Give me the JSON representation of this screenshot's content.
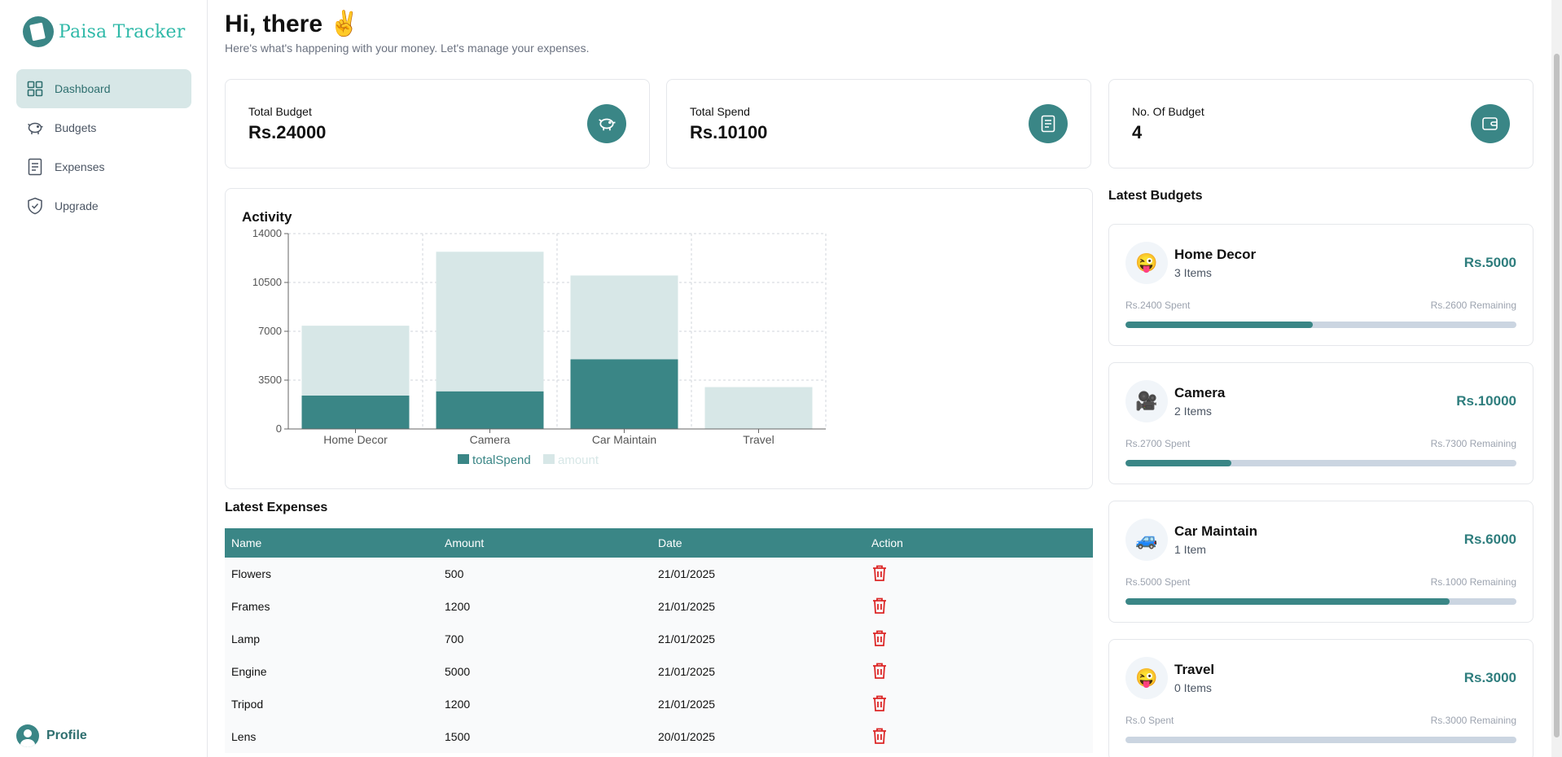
{
  "app": {
    "name": "Paisa Tracker"
  },
  "sidebar": {
    "items": [
      {
        "label": "Dashboard",
        "icon": "grid-icon",
        "active": true
      },
      {
        "label": "Budgets",
        "icon": "piggy-bank-icon",
        "active": false
      },
      {
        "label": "Expenses",
        "icon": "receipt-icon",
        "active": false
      },
      {
        "label": "Upgrade",
        "icon": "shield-check-icon",
        "active": false
      }
    ],
    "profile_label": "Profile"
  },
  "header": {
    "greeting": "Hi, there ✌️",
    "subtitle": "Here's what's happening with your money. Let's manage your expenses."
  },
  "stats": [
    {
      "label": "Total Budget",
      "value": "Rs.24000",
      "icon": "piggy-bank-icon"
    },
    {
      "label": "Total Spend",
      "value": "Rs.10100",
      "icon": "receipt-icon"
    },
    {
      "label": "No. Of Budget",
      "value": "4",
      "icon": "wallet-icon"
    }
  ],
  "activity": {
    "title": "Activity"
  },
  "chart_data": {
    "type": "bar",
    "stacked": true,
    "categories": [
      "Home Decor",
      "Camera",
      "Car Maintain",
      "Travel"
    ],
    "series": [
      {
        "name": "totalSpend",
        "values": [
          2400,
          2700,
          5000,
          0
        ],
        "color": "#3a8686"
      },
      {
        "name": "amount",
        "values": [
          5000,
          10000,
          6000,
          3000
        ],
        "color": "#d7e7e7"
      }
    ],
    "yticks": [
      0,
      3500,
      7000,
      10500,
      14000
    ],
    "ylim": [
      0,
      14000
    ],
    "grid": true,
    "legend": "bottom"
  },
  "latest_expenses": {
    "title": "Latest Expenses",
    "columns": [
      "Name",
      "Amount",
      "Date",
      "Action"
    ],
    "rows": [
      {
        "name": "Flowers",
        "amount": "500",
        "date": "21/01/2025"
      },
      {
        "name": "Frames",
        "amount": "1200",
        "date": "21/01/2025"
      },
      {
        "name": "Lamp",
        "amount": "700",
        "date": "21/01/2025"
      },
      {
        "name": "Engine",
        "amount": "5000",
        "date": "21/01/2025"
      },
      {
        "name": "Tripod",
        "amount": "1200",
        "date": "21/01/2025"
      },
      {
        "name": "Lens",
        "amount": "1500",
        "date": "20/01/2025"
      }
    ],
    "action_icon": "trash-icon"
  },
  "latest_budgets": {
    "title": "Latest Budgets",
    "items": [
      {
        "emoji": "😜",
        "name": "Home Decor",
        "items": "3 Items",
        "amount": "Rs.5000",
        "spent": "Rs.2400 Spent",
        "remaining": "Rs.2600 Remaining",
        "progress": 0.48
      },
      {
        "emoji": "🎥",
        "name": "Camera",
        "items": "2 Items",
        "amount": "Rs.10000",
        "spent": "Rs.2700 Spent",
        "remaining": "Rs.7300 Remaining",
        "progress": 0.27
      },
      {
        "emoji": "🚙",
        "name": "Car Maintain",
        "items": "1 Item",
        "amount": "Rs.6000",
        "spent": "Rs.5000 Spent",
        "remaining": "Rs.1000 Remaining",
        "progress": 0.83
      },
      {
        "emoji": "😜",
        "name": "Travel",
        "items": "0 Items",
        "amount": "Rs.3000",
        "spent": "Rs.0 Spent",
        "remaining": "Rs.3000 Remaining",
        "progress": 0
      }
    ]
  },
  "colors": {
    "accent": "#3a8686",
    "accent_light": "#d7e7e7",
    "brand_text": "#2fb9a8",
    "danger": "#dc2626"
  }
}
